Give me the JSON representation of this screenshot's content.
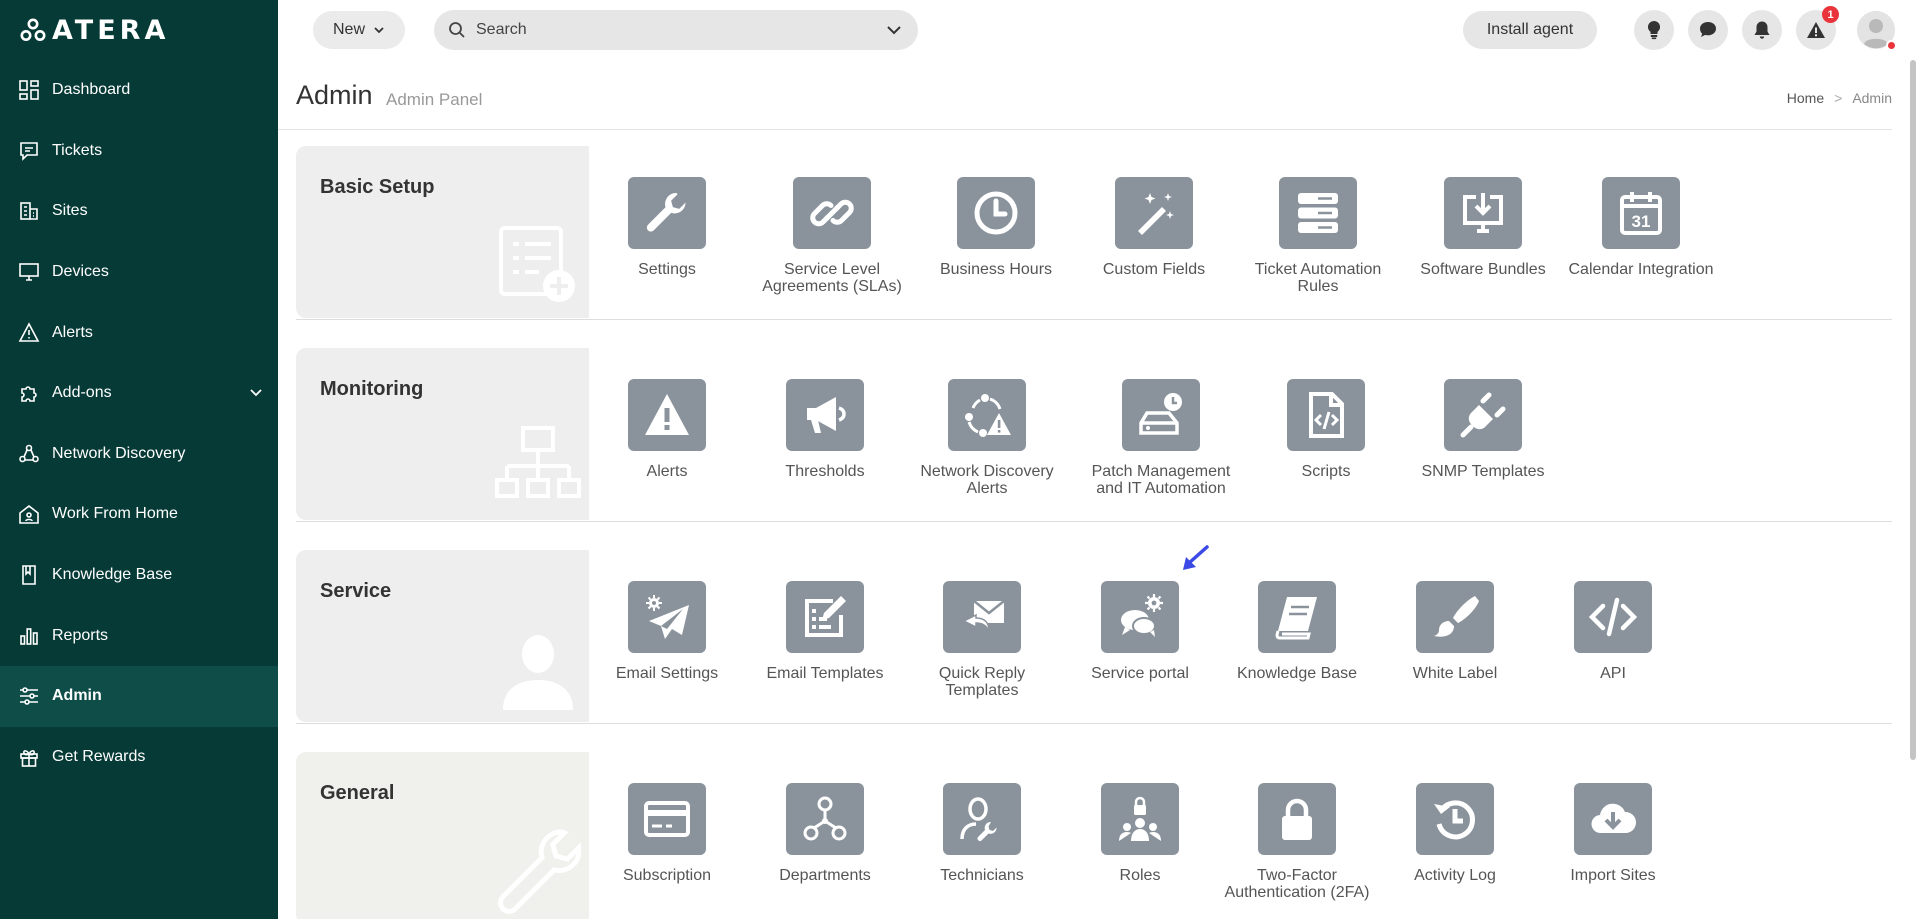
{
  "app": {
    "name": "ATERA"
  },
  "sidebar": {
    "items": [
      {
        "label": "Dashboard",
        "icon": "dashboard-icon"
      },
      {
        "label": "Tickets",
        "icon": "tickets-icon"
      },
      {
        "label": "Sites",
        "icon": "sites-icon"
      },
      {
        "label": "Devices",
        "icon": "devices-icon"
      },
      {
        "label": "Alerts",
        "icon": "alerts-icon"
      },
      {
        "label": "Add-ons",
        "icon": "addons-icon"
      },
      {
        "label": "Network Discovery",
        "icon": "network-discovery-icon"
      },
      {
        "label": "Work From Home",
        "icon": "work-from-home-icon"
      },
      {
        "label": "Knowledge Base",
        "icon": "knowledge-base-icon"
      },
      {
        "label": "Reports",
        "icon": "reports-icon"
      },
      {
        "label": "Admin",
        "icon": "admin-icon",
        "active": true
      },
      {
        "label": "Get Rewards",
        "icon": "rewards-icon"
      }
    ]
  },
  "topbar": {
    "new_label": "New",
    "search_placeholder": "Search",
    "install_label": "Install agent",
    "alert_count": "1"
  },
  "header": {
    "title": "Admin",
    "subtitle": "Admin Panel",
    "breadcrumb": {
      "home": "Home",
      "separator": ">",
      "current": "Admin"
    }
  },
  "sections": [
    {
      "title": "Basic Setup",
      "tiles": [
        {
          "label": "Settings",
          "icon": "wrench-icon"
        },
        {
          "label": "Service Level Agreements (SLAs)",
          "icon": "chain-link-icon"
        },
        {
          "label": "Business Hours",
          "icon": "clock-icon"
        },
        {
          "label": "Custom Fields",
          "icon": "magic-wand-icon"
        },
        {
          "label": "Ticket Automation Rules",
          "icon": "server-stack-icon"
        },
        {
          "label": "Software Bundles",
          "icon": "download-monitor-icon"
        },
        {
          "label": "Calendar Integration",
          "icon": "calendar-icon",
          "text": "31"
        }
      ]
    },
    {
      "title": "Monitoring",
      "tiles": [
        {
          "label": "Alerts",
          "icon": "warning-icon"
        },
        {
          "label": "Thresholds",
          "icon": "megaphone-icon"
        },
        {
          "label": "Network Discovery Alerts",
          "icon": "network-alert-icon"
        },
        {
          "label": "Patch Management and IT Automation",
          "icon": "drive-clock-icon"
        },
        {
          "label": "Scripts",
          "icon": "script-file-icon"
        },
        {
          "label": "SNMP Templates",
          "icon": "plug-icon"
        }
      ]
    },
    {
      "title": "Service",
      "tiles": [
        {
          "label": "Email Settings",
          "icon": "email-settings-icon"
        },
        {
          "label": "Email Templates",
          "icon": "email-templates-icon"
        },
        {
          "label": "Quick Reply Templates",
          "icon": "quick-reply-icon"
        },
        {
          "label": "Service portal",
          "icon": "service-portal-icon"
        },
        {
          "label": "Knowledge Base",
          "icon": "book-icon"
        },
        {
          "label": "White Label",
          "icon": "brush-icon"
        },
        {
          "label": "API",
          "icon": "code-icon"
        }
      ]
    },
    {
      "title": "General",
      "tiles": [
        {
          "label": "Subscription",
          "icon": "credit-card-icon"
        },
        {
          "label": "Departments",
          "icon": "departments-icon"
        },
        {
          "label": "Technicians",
          "icon": "technician-icon"
        },
        {
          "label": "Roles",
          "icon": "roles-icon"
        },
        {
          "label": "Two-Factor Authentication (2FA)",
          "icon": "lock-icon"
        },
        {
          "label": "Activity Log",
          "icon": "activity-log-icon"
        },
        {
          "label": "Import Sites",
          "icon": "cloud-download-icon"
        }
      ]
    }
  ],
  "colors": {
    "sidebar_bg": "#063a36",
    "sidebar_active": "#0e4d48",
    "tile_icon_bg": "#8a939c",
    "badge": "#e8343a",
    "pointer_arrow": "#3b49e6"
  }
}
